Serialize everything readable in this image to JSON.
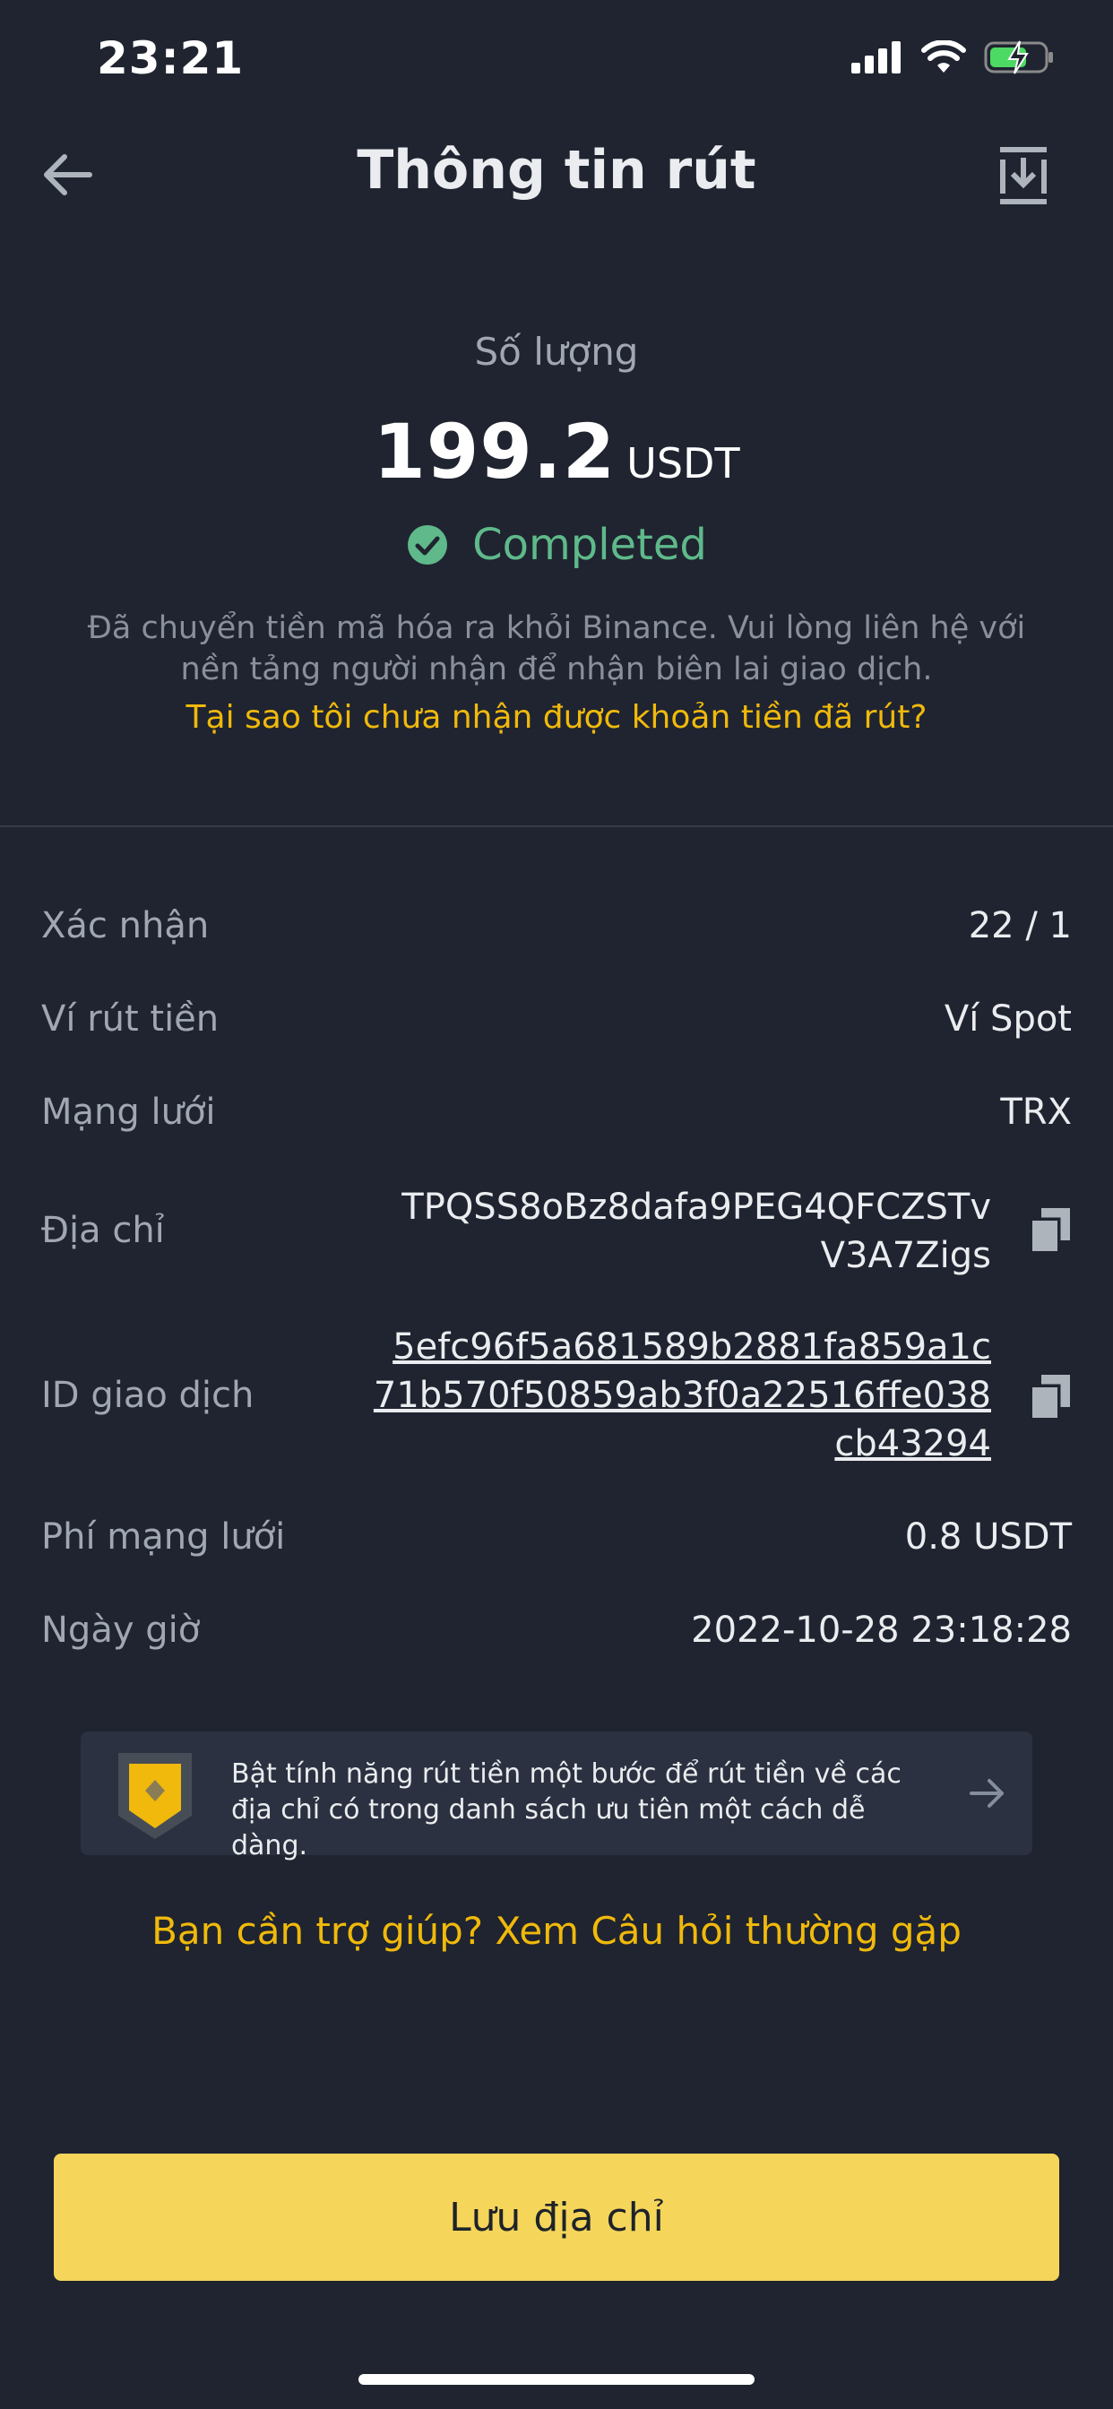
{
  "status_bar": {
    "time": "23:21"
  },
  "header": {
    "title": "Thông tin rút"
  },
  "summary": {
    "quantity_label": "Số lượng",
    "amount": "199.2",
    "unit": "USDT",
    "status": "Completed",
    "description": "Đã chuyển tiền mã hóa ra khỏi Binance. Vui lòng liên hệ với nền tảng người nhận để nhận biên lai giao dịch.",
    "why_link": "Tại sao tôi chưa nhận được khoản tiền đã rút?"
  },
  "details": {
    "confirm": {
      "label": "Xác nhận",
      "value": "22 / 1"
    },
    "wallet": {
      "label": "Ví rút tiền",
      "value": "Ví Spot"
    },
    "network": {
      "label": "Mạng lưới",
      "value": "TRX"
    },
    "address": {
      "label": "Địa chỉ",
      "line1": "TPQSS8oBz8dafa9PEG4QFCZSTv",
      "line2": "V3A7Zigs"
    },
    "txid": {
      "label": "ID giao dịch",
      "line1": "5efc96f5a681589b2881fa859a1c",
      "line2": "71b570f50859ab3f0a22516ffe038",
      "line3": "cb43294"
    },
    "fee": {
      "label": "Phí mạng lưới",
      "value": "0.8 USDT"
    },
    "datetime": {
      "label": "Ngày giờ",
      "value": "2022-10-28 23:18:28"
    }
  },
  "banner": {
    "text": "Bật tính năng rút tiền một bước để rút tiền về các địa chỉ có trong danh sách ưu tiên một cách dễ dàng."
  },
  "help_link": "Bạn cần trợ giúp? Xem Câu hỏi thường gặp",
  "save_button": "Lưu địa chỉ",
  "colors": {
    "background": "#1f2430",
    "accent": "#f0b90b",
    "button": "#f5d55a",
    "success": "#5fb98a",
    "battery": "#4cd964"
  },
  "icons": [
    "back-arrow-icon",
    "download-icon",
    "check-circle-icon",
    "copy-icon",
    "shield-icon",
    "arrow-right-icon"
  ]
}
